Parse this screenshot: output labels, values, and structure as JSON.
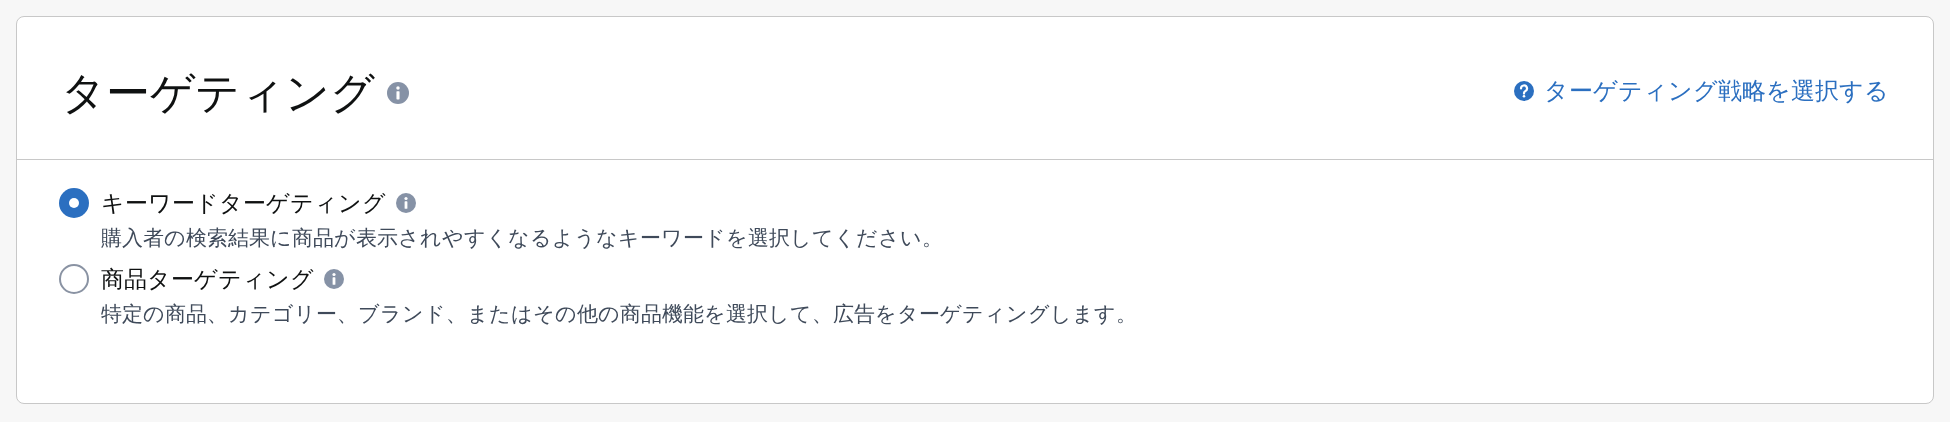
{
  "card": {
    "title": "ターゲティング",
    "help_link": "ターゲティング戦略を選択する"
  },
  "options": [
    {
      "label": "キーワードターゲティング",
      "description": "購入者の検索結果に商品が表示されやすくなるようなキーワードを選択してください。",
      "selected": true
    },
    {
      "label": "商品ターゲティング",
      "description": "特定の商品、カテゴリー、ブランド、またはその他の商品機能を選択して、広告をターゲティングします。",
      "selected": false
    }
  ]
}
